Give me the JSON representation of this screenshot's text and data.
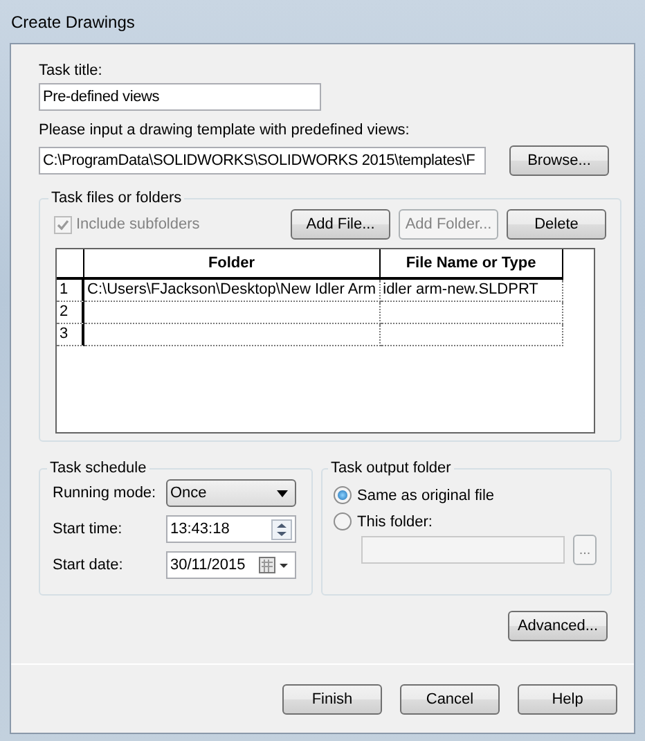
{
  "window": {
    "title": "Create Drawings"
  },
  "task_title": {
    "label": "Task title:",
    "value": "Pre-defined views"
  },
  "template": {
    "label": "Please input a drawing template with predefined views:",
    "value": "C:\\ProgramData\\SOLIDWORKS\\SOLIDWORKS 2015\\templates\\F",
    "browse_button": "Browse..."
  },
  "files_group": {
    "title": "Task files or folders",
    "include_subfolders": {
      "label": "Include subfolders",
      "checked": true,
      "disabled": true
    },
    "buttons": [
      {
        "label": "Add File...",
        "disabled": false
      },
      {
        "label": "Add Folder...",
        "disabled": true
      },
      {
        "label": "Delete",
        "disabled": false
      }
    ],
    "table": {
      "columns": [
        "Folder",
        "File Name or Type"
      ],
      "rows": [
        {
          "number": "1",
          "folder": "C:\\Users\\FJackson\\Desktop\\New Idler Arm",
          "file": "idler arm-new.SLDPRT"
        },
        {
          "number": "2"
        },
        {
          "number": "3"
        }
      ]
    }
  },
  "schedule": {
    "title": "Task schedule",
    "running_mode": {
      "label": "Running mode:",
      "value": "Once"
    },
    "start_time": {
      "label": "Start time:",
      "value": "13:43:18"
    },
    "start_date": {
      "label": "Start date:",
      "value": "30/11/2015"
    }
  },
  "output": {
    "title": "Task output folder",
    "options": [
      {
        "label": "Same as original file",
        "selected": true
      },
      {
        "label": "This folder:",
        "selected": false
      }
    ],
    "folder_field": {
      "disabled": true
    },
    "browse_button": {
      "label": "...",
      "disabled": true
    }
  },
  "advanced_button": "Advanced...",
  "footer_buttons": [
    "Finish",
    "Cancel",
    "Help"
  ]
}
